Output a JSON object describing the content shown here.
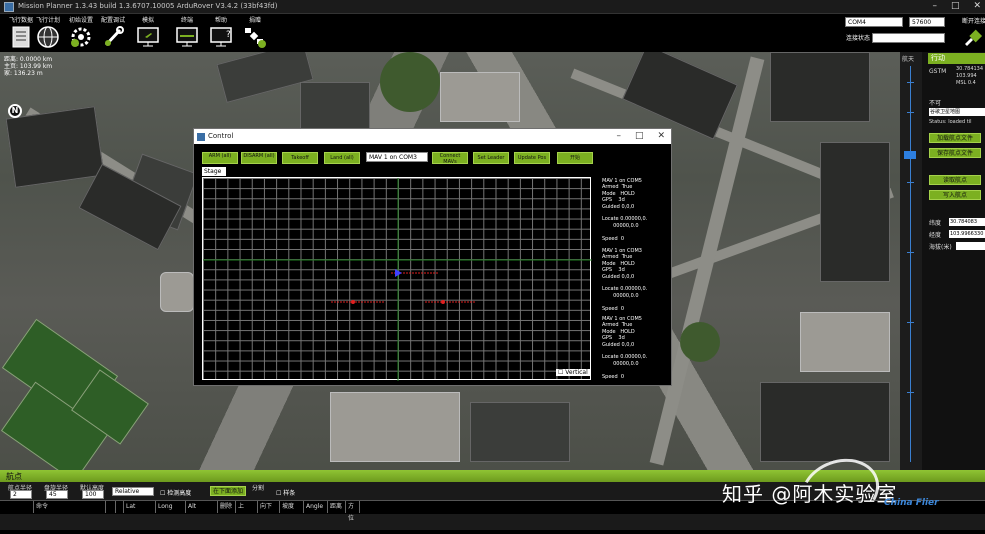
{
  "window": {
    "title": "Mission Planner 1.3.43 build 1.3.6707.10005 ArduRover V3.4.2 (33bf43fd)"
  },
  "menu": [
    {
      "label": "飞行数据",
      "icon": "flight-data-icon"
    },
    {
      "label": "飞行计划",
      "icon": "globe-icon"
    },
    {
      "label": "初始设置",
      "icon": "gear-plus-icon"
    },
    {
      "label": "配置调试",
      "icon": "wrench-icon"
    },
    {
      "label": "模拟",
      "icon": "monitor-plane-icon"
    },
    {
      "label": "终端",
      "icon": "monitor-terminal-icon"
    },
    {
      "label": "帮助",
      "icon": "monitor-help-icon"
    },
    {
      "label": "捐赠",
      "icon": "satellite-donate-icon"
    }
  ],
  "connection": {
    "port": "COM4",
    "baud": "57600",
    "connect_label": "断开连接",
    "stats_label": "连接状态"
  },
  "hud": {
    "distance": "距离: 0.0000 km",
    "home": "主页: 103.99 km",
    "dist2": "家: 136.23 m"
  },
  "compass": {
    "label": "N"
  },
  "scale": {
    "label": "航天"
  },
  "right_panel": {
    "header": "行动",
    "lat_label": "纬度",
    "lat_value": "30.784134",
    "lng_value": "103.994",
    "alt_value": "MSL 0.4",
    "gps_label": "GSTM",
    "checkbox_label": "不可",
    "dropdown": "谷歌卫星地图",
    "status": "Status: loaded til",
    "btn_load": "加载航点文件",
    "btn_save": "保存航点文件",
    "btn_read": "读取航点",
    "btn_write": "写入航点",
    "lat2_label": "纬度",
    "lat2_value": "30.784083",
    "lng2_label": "经度",
    "lng2_value": "103.9966330",
    "alt2_label": "海拔(米)"
  },
  "bottom": {
    "header": "航点",
    "wp_radius_label": "航点半径",
    "wp_radius_value": "2",
    "loiter_label": "盘旋半径",
    "loiter_value": "45",
    "default_alt_label": "默认高度",
    "default_alt_value": "100",
    "alt_mode": "Relative",
    "verify_label": "检测高度",
    "add_below_label": "在下面添加",
    "spline_label": "样条",
    "split_label": "分割",
    "columns": [
      "命令",
      "",
      "",
      "Lat",
      "Long",
      "Alt",
      "删除",
      "上",
      "向下",
      "坡度",
      "Angle",
      "距离",
      "方位"
    ]
  },
  "watermark": {
    "text": "知乎 @阿木实验室",
    "brand": "China Flier"
  },
  "dialog": {
    "title": "Control",
    "buttons": [
      "ARM (all)",
      "DISARM (all)",
      "Takeoff",
      "Land (all)",
      "Connect MAVs",
      "Set Leader",
      "Update Pos",
      "开始"
    ],
    "mav_select": "MAV 1 on COM3",
    "stage_tab": "Stage 1",
    "vertical_label": "Vertical",
    "mavs": [
      {
        "head": "MAV 1 on COM5",
        "armed": "Armed  True",
        "mode": "Mode   HOLD",
        "gps": "GPS    3d",
        "guided": "Guided 0,0,0",
        "locate": "Locate 0.00000,0.\n       00000,0.0",
        "speed": "Speed  0"
      },
      {
        "head": "MAV 1 on COM3",
        "armed": "Armed  True",
        "mode": "Mode   HOLD",
        "gps": "GPS    3d",
        "guided": "Guided 0,0,0",
        "locate": "Locate 0.00000,0.\n       00000,0.0",
        "speed": "Speed  0"
      },
      {
        "head": "MAV 1 on COM5",
        "armed": "Armed  True",
        "mode": "Mode   HOLD",
        "gps": "GPS    3d",
        "guided": "Guided 0,0,0",
        "locate": "Locate 0.00000,0.\n       00000,0.0",
        "speed": "Speed  0"
      }
    ]
  },
  "colors": {
    "accent": "#7cb021",
    "grid": "#777777",
    "marker_red": "#e02020",
    "scale_blue": "#3a7fd0"
  }
}
